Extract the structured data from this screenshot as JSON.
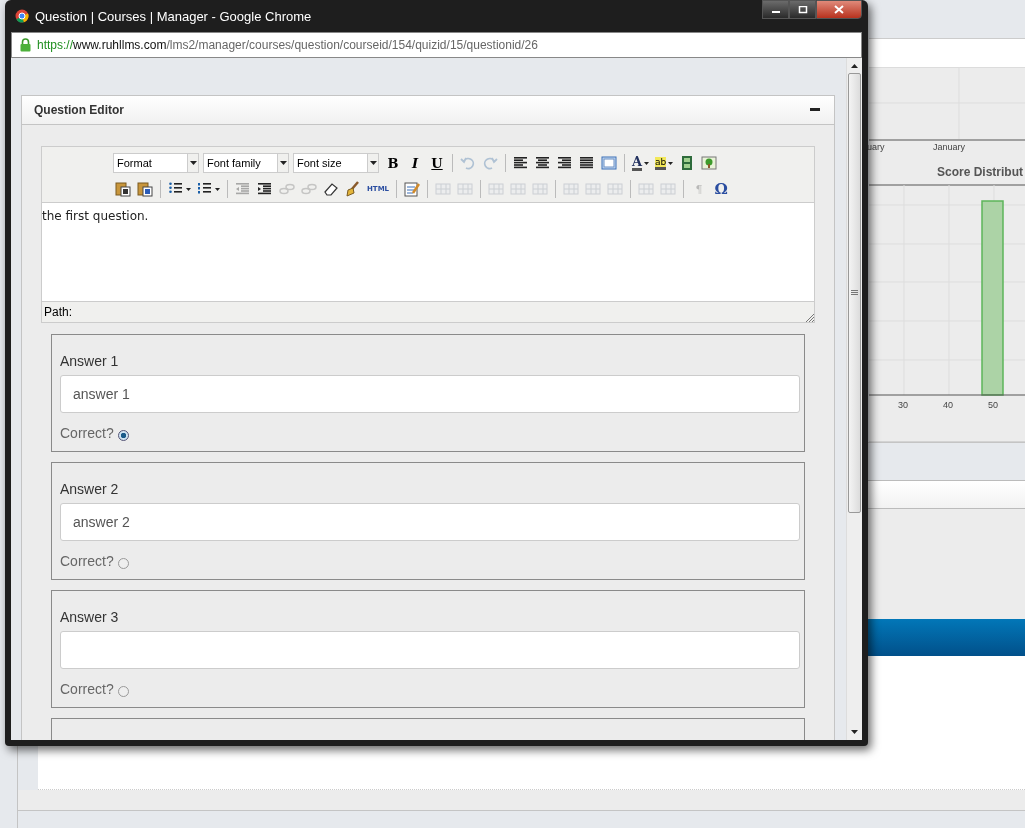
{
  "window": {
    "title": "Question | Courses | Manager - Google Chrome",
    "url_scheme": "https://",
    "url_host": "www.ruhllms.com",
    "url_path": "/lms2/manager/courses/question/courseid/154/quizid/15/questionid/26"
  },
  "panel": {
    "title": "Question Editor"
  },
  "editor": {
    "toolbar_rows": [
      [
        {
          "kind": "select",
          "label": "Format"
        },
        {
          "kind": "select",
          "label": "Font family"
        },
        {
          "kind": "select",
          "label": "Font size"
        },
        {
          "kind": "glyph",
          "label": "B",
          "disabled": false
        },
        {
          "kind": "glyph",
          "label": "I",
          "disabled": false
        },
        {
          "kind": "glyph",
          "label": "U",
          "disabled": false
        },
        {
          "kind": "sep"
        },
        {
          "kind": "button",
          "disabled": true
        },
        {
          "kind": "button",
          "disabled": true
        },
        {
          "kind": "sep"
        },
        {
          "kind": "button",
          "disabled": false
        },
        {
          "kind": "button",
          "disabled": false
        },
        {
          "kind": "button",
          "disabled": false
        },
        {
          "kind": "button",
          "disabled": false
        },
        {
          "kind": "button",
          "disabled": false
        },
        {
          "kind": "sep"
        },
        {
          "kind": "glyph-menu",
          "label": "A",
          "disabled": false
        },
        {
          "kind": "glyph-menu",
          "label": "ab",
          "disabled": false
        },
        {
          "kind": "button",
          "disabled": false
        },
        {
          "kind": "button",
          "disabled": false
        }
      ],
      [
        {
          "kind": "button",
          "disabled": false
        },
        {
          "kind": "button",
          "disabled": false
        },
        {
          "kind": "sep"
        },
        {
          "kind": "button-menu",
          "disabled": false
        },
        {
          "kind": "button-menu",
          "disabled": false
        },
        {
          "kind": "sep"
        },
        {
          "kind": "button",
          "disabled": true
        },
        {
          "kind": "button",
          "disabled": false
        },
        {
          "kind": "button",
          "disabled": true
        },
        {
          "kind": "button",
          "disabled": true
        },
        {
          "kind": "button",
          "disabled": false
        },
        {
          "kind": "button",
          "disabled": false
        },
        {
          "kind": "glyph",
          "label": "HTML",
          "disabled": false
        },
        {
          "kind": "sep"
        },
        {
          "kind": "button",
          "disabled": false
        },
        {
          "kind": "sep"
        },
        {
          "kind": "button",
          "disabled": true
        },
        {
          "kind": "button",
          "disabled": true
        },
        {
          "kind": "sep"
        },
        {
          "kind": "button",
          "disabled": true
        },
        {
          "kind": "button",
          "disabled": true
        },
        {
          "kind": "button",
          "disabled": true
        },
        {
          "kind": "sep"
        },
        {
          "kind": "button",
          "disabled": true
        },
        {
          "kind": "button",
          "disabled": true
        },
        {
          "kind": "button",
          "disabled": true
        },
        {
          "kind": "sep"
        },
        {
          "kind": "button",
          "disabled": true
        },
        {
          "kind": "button",
          "disabled": true
        },
        {
          "kind": "sep"
        },
        {
          "kind": "glyph",
          "label": "¶",
          "disabled": true
        },
        {
          "kind": "glyph",
          "label": "Ω",
          "disabled": false
        }
      ]
    ],
    "content": "the first question.",
    "path_label": "Path:"
  },
  "answers": [
    {
      "label": "Answer 1",
      "value": "answer 1",
      "correct_label": "Correct?",
      "selected": true
    },
    {
      "label": "Answer 2",
      "value": "answer 2",
      "correct_label": "Correct?",
      "selected": false
    },
    {
      "label": "Answer 3",
      "correct_label": "Correct?",
      "selected": false
    }
  ],
  "background": {
    "month_labels": [
      "uary",
      "January"
    ],
    "chart_title": "Score Distribut",
    "x_labels": [
      "30",
      "40",
      "50"
    ]
  }
}
